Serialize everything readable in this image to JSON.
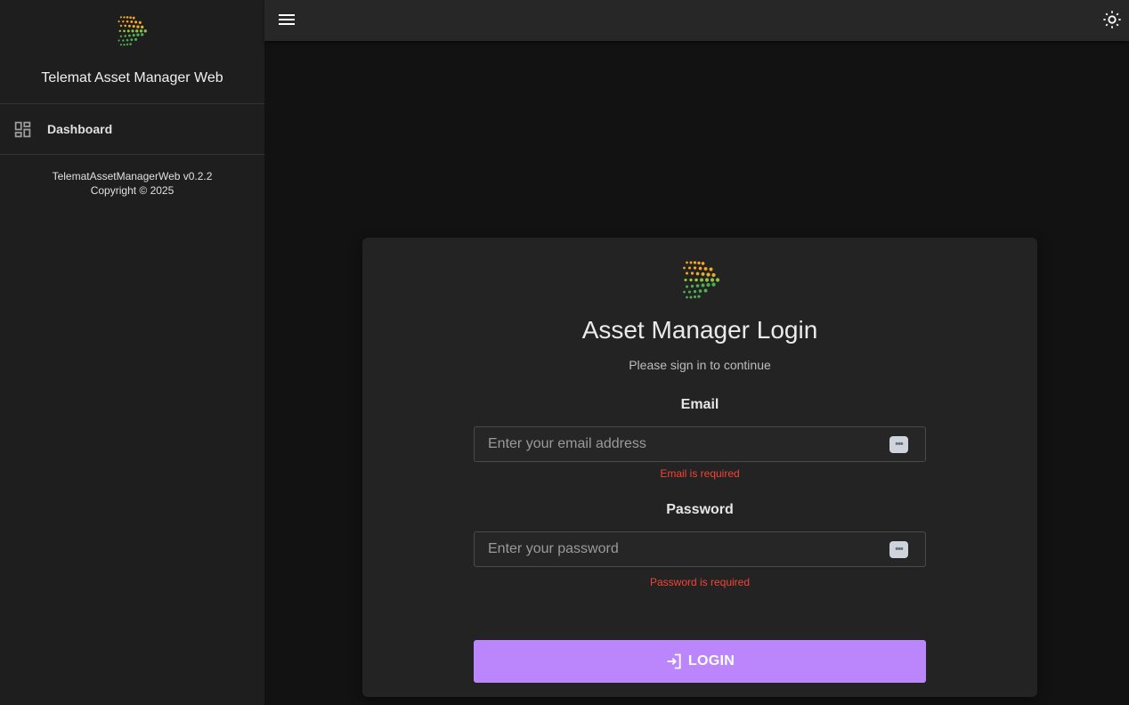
{
  "sidebar": {
    "app_title": "Telemat Asset Manager Web",
    "logo_icon": "telemat-logo-icon",
    "nav_items": [
      {
        "label": "Dashboard",
        "icon": "dashboard-icon"
      }
    ],
    "version": "TelematAssetManagerWeb v0.2.2",
    "copyright": "Copyright © 2025"
  },
  "topbar": {
    "menu_icon": "hamburger-menu-icon",
    "theme_icon": "brightness-icon"
  },
  "login": {
    "title": "Asset Manager Login",
    "subtitle": "Please sign in to continue",
    "email": {
      "label": "Email",
      "placeholder": "Enter your email address",
      "value": "",
      "error": "Email is required"
    },
    "password": {
      "label": "Password",
      "placeholder": "Enter your password",
      "value": "",
      "error": "Password is required"
    },
    "submit_label": "LOGIN"
  },
  "colors": {
    "accent": "#bb86fc",
    "error": "#f44336",
    "logo_orange": "#f5a623",
    "logo_green": "#4caf50"
  }
}
